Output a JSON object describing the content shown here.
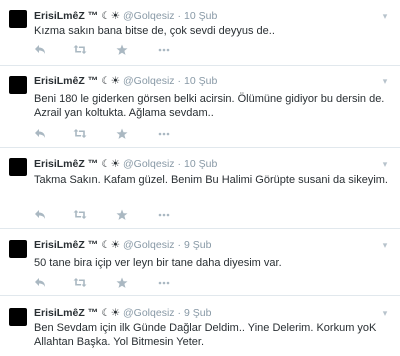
{
  "tweets": [
    {
      "name": "ErisiLmêZ ™",
      "symbols": "☾☀",
      "handle": "@Golqesiz",
      "time": "10 Şub",
      "text": "Kızma sakın bana bitse de, çok sevdi deyyus de.."
    },
    {
      "name": "ErisiLmêZ ™",
      "symbols": "☾☀",
      "handle": "@Golqesiz",
      "time": "10 Şub",
      "text": "Beni 180 le giderken görsen belki acirsin.  Ölümüne gidiyor bu dersin de. Azrail yan koltukta.  Ağlama sevdam.."
    },
    {
      "name": "ErisiLmêZ ™",
      "symbols": "☾☀",
      "handle": "@Golqesiz",
      "time": "10 Şub",
      "text": "Takma Sakın.  Kafam güzel.  Benim Bu Halimi Görüpte susani da sikeyim."
    },
    {
      "name": "ErisiLmêZ ™",
      "symbols": "☾☀",
      "handle": "@Golqesiz",
      "time": "9 Şub",
      "text": "50 tane bira içip ver leyn bir tane daha diyesim var."
    },
    {
      "name": "ErisiLmêZ ™",
      "symbols": "☾☀",
      "handle": "@Golqesiz",
      "time": "9 Şub",
      "text": "Ben Sevdam için ilk Günde Dağlar Deldim.. Yine Delerim.  Korkum yoK Allahtan Başka. Yol Bitmesin Yeter."
    }
  ],
  "icons": {
    "reply": "reply-icon",
    "retweet": "retweet-icon",
    "favorite": "star-icon",
    "more": "more-dots-icon",
    "caret": "chevron-down-icon"
  },
  "colors": {
    "text": "#292f33",
    "meta": "#8899a6",
    "action": "#aab8c2",
    "divider": "#e1e8ed"
  }
}
